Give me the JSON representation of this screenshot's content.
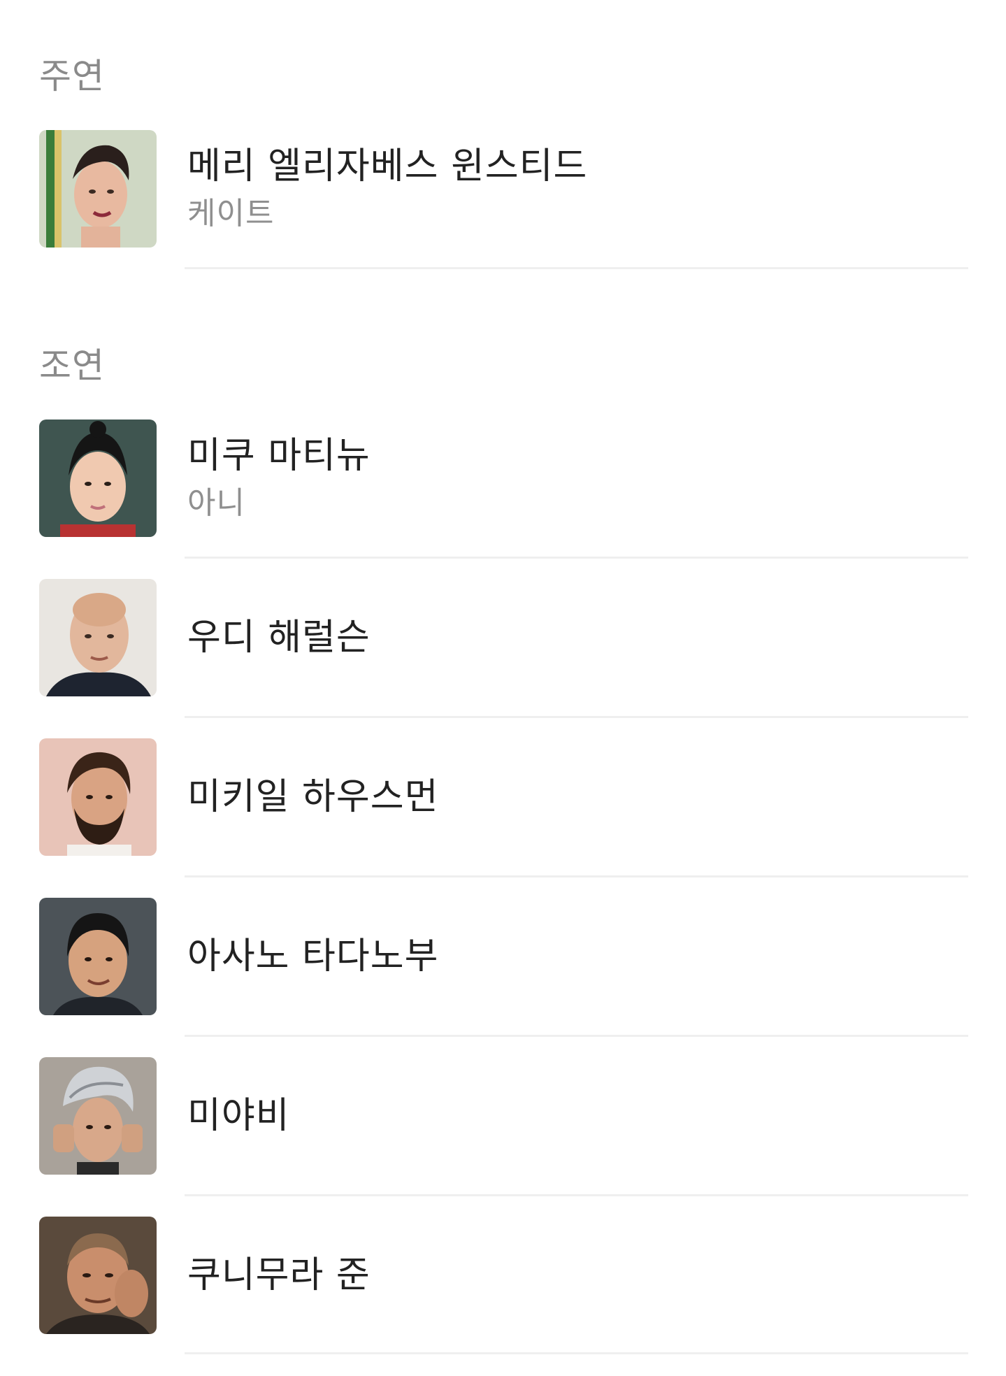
{
  "sections": {
    "lead": {
      "label": "주연"
    },
    "supporting": {
      "label": "조연"
    }
  },
  "cast": [
    {
      "name": "메리 엘리자베스 윈스티드",
      "role": "케이트",
      "avatar_icon": "actor-photo"
    },
    {
      "name": "미쿠 마티뉴",
      "role": "아니",
      "avatar_icon": "actor-photo"
    },
    {
      "name": "우디 해럴슨",
      "role": "",
      "avatar_icon": "actor-photo"
    },
    {
      "name": "미키일 하우스먼",
      "role": "",
      "avatar_icon": "actor-photo"
    },
    {
      "name": "아사노 타다노부",
      "role": "",
      "avatar_icon": "actor-photo"
    },
    {
      "name": "미야비",
      "role": "",
      "avatar_icon": "actor-photo"
    },
    {
      "name": "쿠니무라 준",
      "role": "",
      "avatar_icon": "actor-photo"
    }
  ],
  "colors": {
    "section_label": "#8a8a8a",
    "name_text": "#222222",
    "role_text": "#8f8f8f",
    "divider": "#efefef"
  }
}
